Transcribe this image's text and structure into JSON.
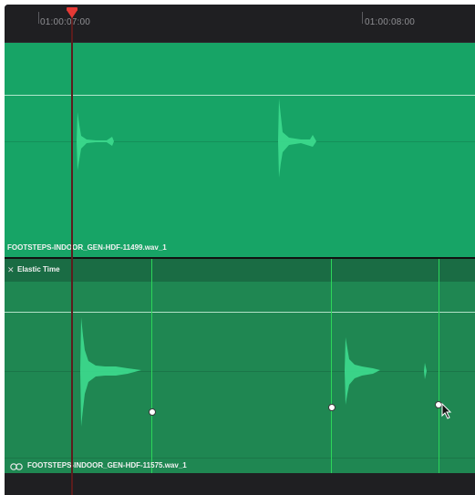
{
  "ruler": {
    "timecodes": [
      "01:00:07:00",
      "01:00:08:00"
    ]
  },
  "tracks": [
    {
      "clip_name": "FOOTSTEPS-INDOOR_GEN-HDF-11499.wav_1"
    },
    {
      "elastic_time_label": "Elastic Time",
      "clip_name": "FOOTSTEPS-INDOOR_GEN-HDF-11575.wav_1"
    }
  ],
  "icons": {
    "playhead": "playhead-marker-icon",
    "close": "close-icon",
    "link": "link-icon",
    "cursor": "arrow-cursor-icon"
  },
  "colors": {
    "track_primary": "#17a466",
    "track_elastic": "#1f8752",
    "waveform": "#3ddc8e",
    "warp_marker": "#2cd65a",
    "playhead": "#e53935"
  }
}
